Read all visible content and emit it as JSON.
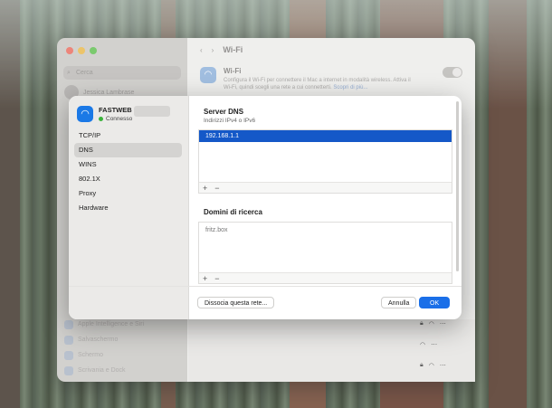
{
  "background_window": {
    "search_placeholder": "Cerca",
    "account_name": "Jessica Lambrase",
    "nav_title": "Wi-Fi",
    "wifi_title": "Wi-Fi",
    "wifi_description": "Configura il Wi-Fi per connettere il Mac a internet in modalità wireless. Attiva il Wi-Fi, quindi scegli una rete a cui connetterti.",
    "wifi_link": "Scopri di più...",
    "sidebar_items": [
      "Apple Intelligence e Siri",
      "Salvaschermo",
      "Schermo",
      "Scrivania e Dock"
    ]
  },
  "sheet": {
    "network_name": "FASTWEB",
    "network_status": "Connesso",
    "nav_items": [
      {
        "label": "TCP/IP",
        "selected": false
      },
      {
        "label": "DNS",
        "selected": true
      },
      {
        "label": "WINS",
        "selected": false
      },
      {
        "label": "802.1X",
        "selected": false
      },
      {
        "label": "Proxy",
        "selected": false
      },
      {
        "label": "Hardware",
        "selected": false
      }
    ],
    "dns": {
      "title": "Server DNS",
      "subtitle": "Indirizzi IPv4 o IPv6",
      "servers": [
        "192.168.1.1"
      ],
      "add_label": "+",
      "remove_label": "−"
    },
    "search_domains": {
      "title": "Domini di ricerca",
      "domains": [
        "fritz.box"
      ],
      "add_label": "+",
      "remove_label": "−"
    },
    "forget_button": "Dissocia questa rete...",
    "cancel_button": "Annulla",
    "ok_button": "OK"
  },
  "colors": {
    "accent": "#1a6fe8",
    "selection": "#1458c8",
    "connected": "#3bb33b"
  }
}
